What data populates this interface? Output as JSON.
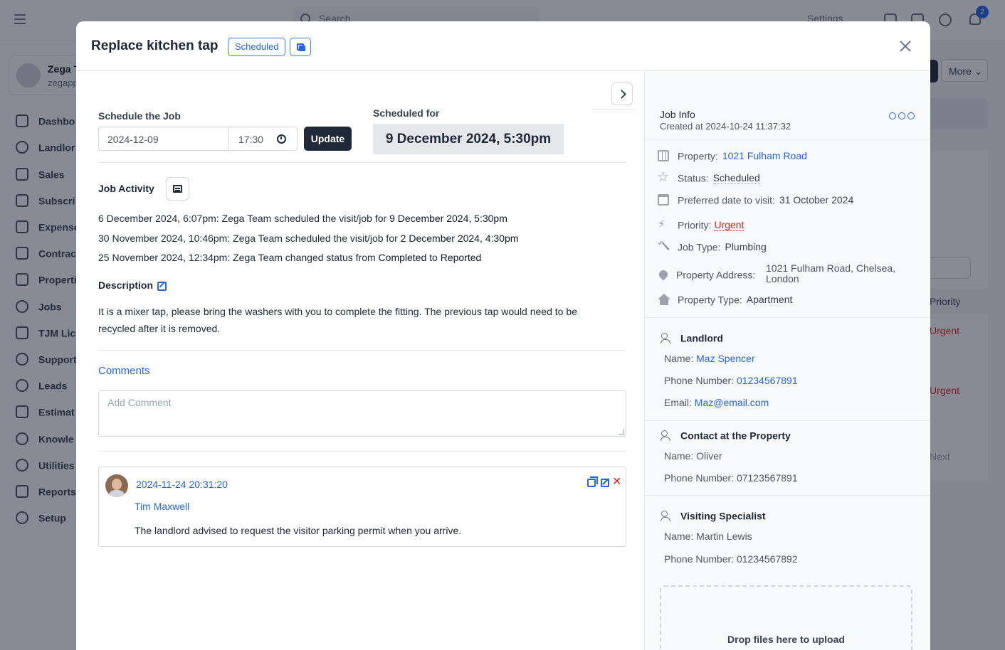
{
  "background": {
    "search_placeholder": "Search",
    "settings_label": "Settings",
    "notification_count": "2",
    "user_name": "Zega T",
    "user_email": "zegapp",
    "nav_items": [
      "Dashbo",
      "Landlor",
      "Sales",
      "Subscri",
      "Expense",
      "Contrac",
      "Properti",
      "Jobs",
      "TJM Lic",
      "Support",
      "Leads",
      "Estimat",
      "Knowle",
      "Utilities",
      "Reports",
      "Setup"
    ],
    "more_label": "More",
    "priority_header": "Priority",
    "urgent_label": "Urgent",
    "next_label": "Next"
  },
  "modal": {
    "title": "Replace kitchen tap",
    "status_chip": "Scheduled",
    "schedule": {
      "label": "Schedule the Job",
      "date_value": "2024-12-09",
      "time_value": "17:30",
      "update_label": "Update",
      "scheduled_for_label": "Scheduled for",
      "scheduled_for_value": "9 December 2024, 5:30pm"
    },
    "activity": {
      "title": "Job Activity",
      "entries": [
        {
          "ts": "6 December 2024, 6:07pm:",
          "text": " Zega Team scheduled the visit/job for ",
          "value": "9 December 2024, 5:30pm",
          "tail": ""
        },
        {
          "ts": "30 November 2024, 10:46pm:",
          "text": " Zega Team scheduled the visit/job for ",
          "value": "2 December 2024, 4:30pm",
          "tail": ""
        },
        {
          "ts": "25 November 2024, 12:34pm:",
          "text": " Zega Team changed status from ",
          "value": "Completed",
          "tail": " to ",
          "value2": "Reported"
        }
      ]
    },
    "description": {
      "title": "Description",
      "text": "It is a mixer tap, please bring the washers with you to complete the fitting. The previous tap would need to be recycled after it is removed."
    },
    "comments": {
      "title": "Comments",
      "placeholder": "Add Comment",
      "items": [
        {
          "date": "2024-11-24 20:31:20",
          "author": "Tim Maxwell",
          "text": "The landlord advised to request the visitor parking permit when you arrive.",
          "delete_glyph": "✕"
        }
      ]
    }
  },
  "job_info": {
    "title": "Job Info",
    "created": "Created at 2024-10-24 11:37:32",
    "property_label": "Property:",
    "property_value": "1021 Fulham Road",
    "status_label": "Status:",
    "status_value": "Scheduled",
    "preferred_label": "Preferred date to visit:",
    "preferred_value": "31 October 2024",
    "priority_label": "Priority:",
    "priority_value": "Urgent",
    "job_type_label": "Job Type:",
    "job_type_value": "Plumbing",
    "address_label": "Property Address:",
    "address_line1": "1021 Fulham Road, Chelsea,",
    "address_line2": "London",
    "property_type_label": "Property Type:",
    "property_type_value": "Apartment"
  },
  "landlord": {
    "title": "Landlord",
    "name_label": "Name:",
    "name_value": "Maz Spencer",
    "phone_label": "Phone Number:",
    "phone_value": "01234567891",
    "email_label": "Email:",
    "email_value": "Maz@email.com"
  },
  "contact": {
    "title": "Contact at the Property",
    "name_label": "Name:",
    "name_value": "Oliver",
    "phone_label": "Phone Number:",
    "phone_value": "07123567891"
  },
  "specialist": {
    "title": "Visiting Specialist",
    "name_label": "Name:",
    "name_value": "Martin Lewis",
    "phone_label": "Phone Number:",
    "phone_value": "01234567892"
  },
  "dropzone_label": "Drop files here to upload",
  "colors": {
    "accent": "#2563eb",
    "danger": "#dc2626",
    "dark_button": "#1f2937"
  }
}
